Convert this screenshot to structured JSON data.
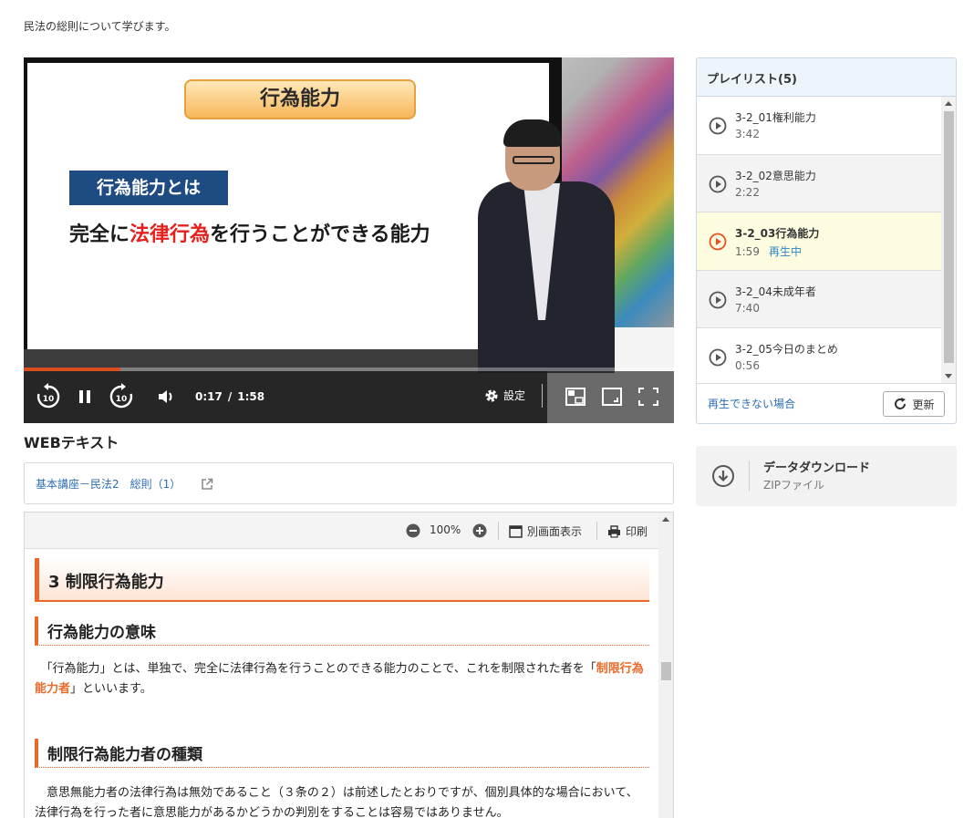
{
  "description": "民法の総則について学びます。",
  "video": {
    "slide_title": "行為能力",
    "slide_term": "行為能力とは",
    "slide_def_pre": "完全に",
    "slide_def_red": "法律行為",
    "slide_def_post": "を行うことができる能力",
    "progress": 0.148,
    "current_time": "0:17",
    "duration": "1:58",
    "time_separator": "/",
    "rewind_label": "10",
    "forward_label": "10",
    "settings_label": "設定",
    "accent_color": "#d9501e"
  },
  "playlist": {
    "title": "プレイリスト(5)",
    "items": [
      {
        "title": "3-2_01権利能力",
        "duration": "3:42",
        "status": ""
      },
      {
        "title": "3-2_02意思能力",
        "duration": "2:22",
        "status": ""
      },
      {
        "title": "3-2_03行為能力",
        "duration": "1:59",
        "status": "再生中"
      },
      {
        "title": "3-2_04未成年者",
        "duration": "7:40",
        "status": ""
      },
      {
        "title": "3-2_05今日のまとめ",
        "duration": "0:56",
        "status": ""
      }
    ],
    "cannot_play_link": "再生できない場合",
    "refresh_label": "更新"
  },
  "download": {
    "title": "データダウンロード",
    "subtitle": "ZIPファイル"
  },
  "web_text": {
    "heading": "WEBテキスト",
    "link": "基本講座－民法2　総則（1）",
    "toolbar": {
      "zoom": "100%",
      "separate_view": "別画面表示",
      "print": "印刷"
    },
    "content": {
      "h3": "3 制限行為能力",
      "h4_1": "行為能力の意味",
      "p1_a": "「行為能力」とは、単独で、完全に法律行為を行うことのできる能力のことで、これを制限された者を「",
      "p1_hl": "制限行為能力者",
      "p1_b": "」といいます。",
      "h4_2": "制限行為能力者の種類",
      "p2": "意思無能力者の法律行為は無効であること（３条の２）は前述したとおりですが、個別具体的な場合において、法律行為を行った者に意思能力があるかどうかの判別をすることは容易ではありません。"
    }
  }
}
